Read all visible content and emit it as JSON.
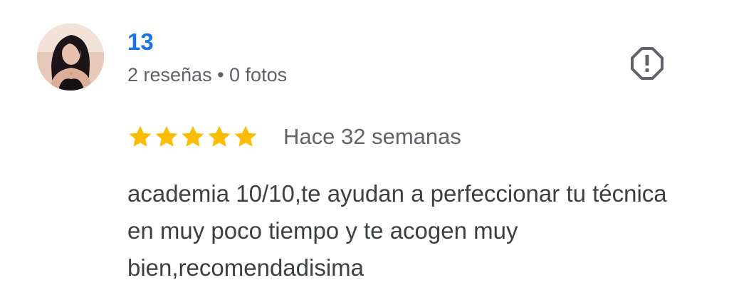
{
  "review": {
    "author": {
      "name": "13",
      "meta": "2 reseñas • 0 fotos",
      "avatar_icon": "user-avatar-photo"
    },
    "report_icon": "report-flag-octagon-icon",
    "rating": {
      "stars": 5,
      "max": 5,
      "color": "#fbbc04"
    },
    "time": "Hace 32 semanas",
    "text": "academia 10/10,te ayudan a perfeccionar tu técnica en muy poco tiempo y te acogen muy bien,recomendadisima"
  },
  "colors": {
    "name": "#1a73e8",
    "secondary_text": "#5f6368",
    "body_text": "#3c4043",
    "icon": "#5f6368"
  }
}
